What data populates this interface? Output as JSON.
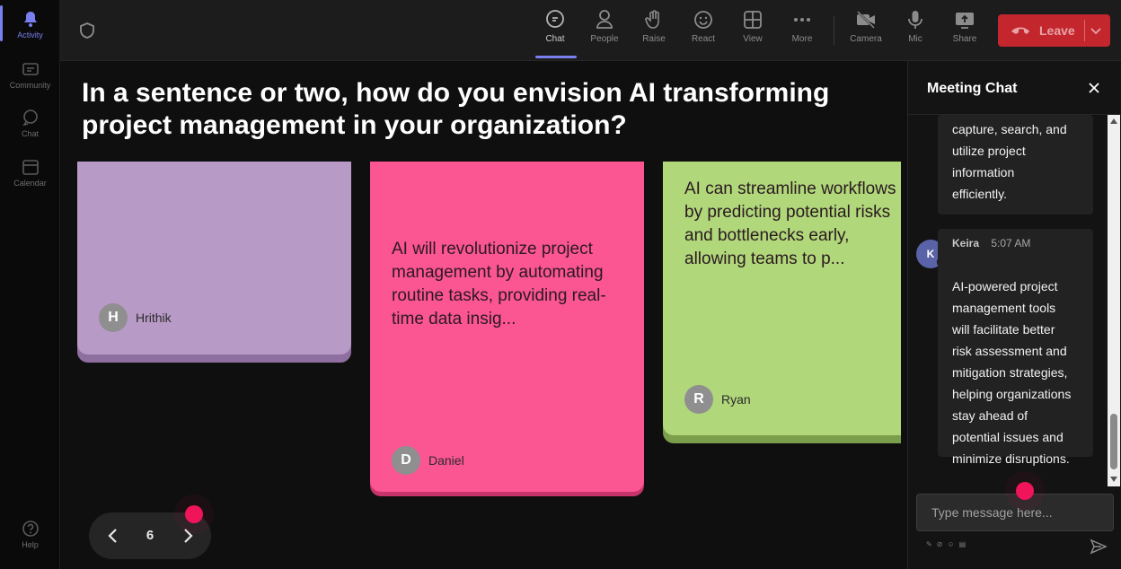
{
  "rail": {
    "items": [
      {
        "label": "Activity"
      },
      {
        "label": "Community"
      },
      {
        "label": "Chat"
      },
      {
        "label": "Calendar"
      },
      {
        "label": "Help"
      }
    ]
  },
  "toolbar": {
    "tools": [
      {
        "label": "Chat"
      },
      {
        "label": "People"
      },
      {
        "label": "Raise"
      },
      {
        "label": "React"
      },
      {
        "label": "View"
      },
      {
        "label": "More"
      },
      {
        "label": "Camera"
      },
      {
        "label": "Mic"
      },
      {
        "label": "Share"
      }
    ],
    "leave_label": "Leave"
  },
  "question": "In a sentence or two, how do you envision AI transforming project management in your organization?",
  "cards": [
    {
      "text": "",
      "author": "Hrithik",
      "initial": "H",
      "color": "#b89ac6",
      "shadow": "#8f6fa0"
    },
    {
      "text": "AI will revolutionize project\nmanagement by automating\nroutine tasks, providing real-\ntime data insig...",
      "author": "Daniel",
      "initial": "D",
      "color": "#fb5592",
      "shadow": "#c6346b"
    },
    {
      "text": "AI can streamline workflows\nby predicting potential risks\nand bottlenecks early,\nallowing teams to p...",
      "author": "Ryan",
      "initial": "R",
      "color": "#b1d77b",
      "shadow": "#7a9e49"
    }
  ],
  "pager": {
    "page": "6"
  },
  "chat": {
    "title": "Meeting Chat",
    "prev_message": "capture, search, and\nutilize project\ninformation\nefficiently.",
    "message": {
      "sender": "Keira",
      "initial": "K",
      "time": "5:07 AM",
      "text": "AI-powered project\nmanagement tools\nwill facilitate better\nrisk assessment and\nmitigation strategies,\nhelping organizations\nstay ahead of\npotential issues and\nminimize disruptions."
    },
    "input_placeholder": "Type message here..."
  },
  "colors": {
    "accent": "#7a7ff0",
    "leave": "#c4262e",
    "marker": "#f0145a"
  }
}
